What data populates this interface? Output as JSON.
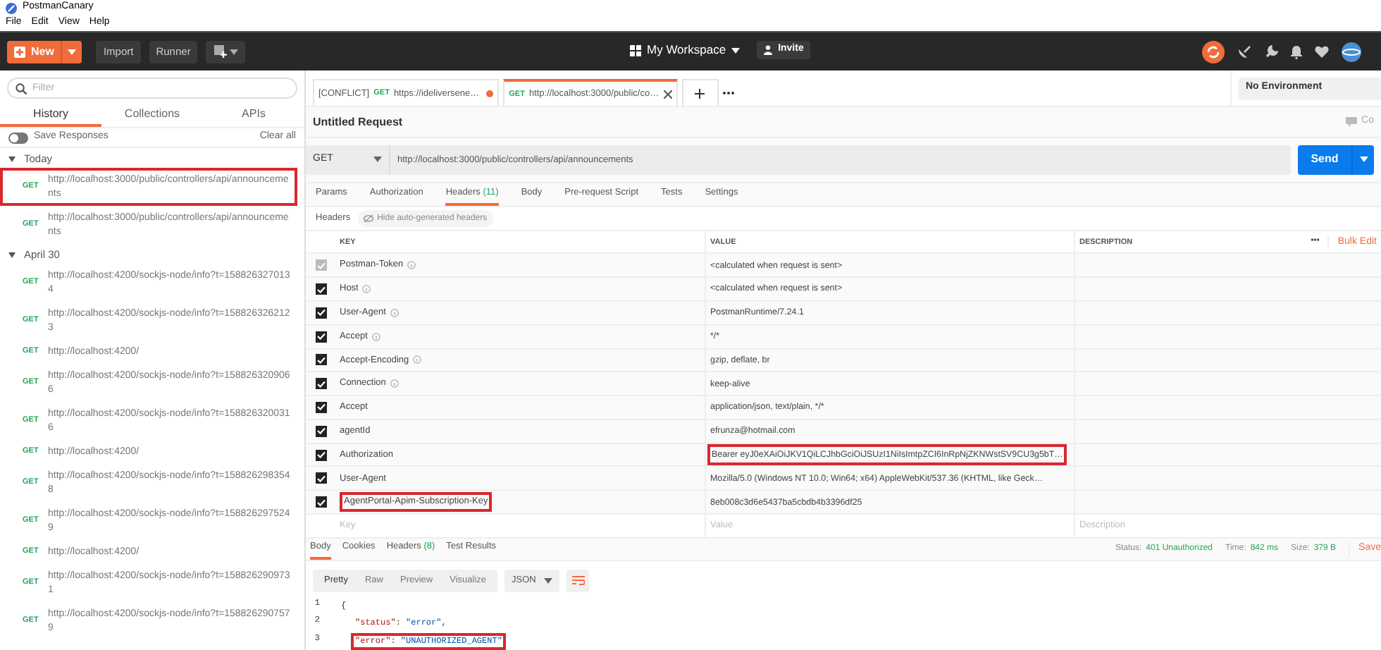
{
  "window": {
    "title": "PostmanCanary"
  },
  "menu": [
    "File",
    "Edit",
    "View",
    "Help"
  ],
  "toolbar": {
    "new": "New",
    "import": "Import",
    "runner": "Runner",
    "workspace": "My Workspace",
    "invite": "Invite"
  },
  "sidebar": {
    "filter_placeholder": "Filter",
    "tabs": [
      {
        "label": "History",
        "selected": true
      },
      {
        "label": "Collections",
        "selected": false
      },
      {
        "label": "APIs",
        "selected": false
      }
    ],
    "save_responses": {
      "label": "Save Responses",
      "on": false
    },
    "clear_all": "Clear all",
    "groups": [
      {
        "label": "Today",
        "expanded": true,
        "items": [
          {
            "method": "GET",
            "url": "http://localhost:3000/public/controllers/api/announcements",
            "highlighted": true
          },
          {
            "method": "GET",
            "url": "http://localhost:3000/public/controllers/api/announcements",
            "highlighted": false
          }
        ]
      },
      {
        "label": "April 30",
        "expanded": true,
        "items": [
          {
            "method": "GET",
            "url": "http://localhost:4200/sockjs-node/info?t=1588263270134",
            "highlighted": false
          },
          {
            "method": "GET",
            "url": "http://localhost:4200/sockjs-node/info?t=1588263262123",
            "highlighted": false
          },
          {
            "method": "GET",
            "url": "http://localhost:4200/",
            "highlighted": false
          },
          {
            "method": "GET",
            "url": "http://localhost:4200/sockjs-node/info?t=1588263209066",
            "highlighted": false
          },
          {
            "method": "GET",
            "url": "http://localhost:4200/sockjs-node/info?t=1588263200316",
            "highlighted": false
          },
          {
            "method": "GET",
            "url": "http://localhost:4200/",
            "highlighted": false
          },
          {
            "method": "GET",
            "url": "http://localhost:4200/sockjs-node/info?t=1588262983548",
            "highlighted": false
          },
          {
            "method": "GET",
            "url": "http://localhost:4200/sockjs-node/info?t=1588262975249",
            "highlighted": false
          },
          {
            "method": "GET",
            "url": "http://localhost:4200/",
            "highlighted": false
          },
          {
            "method": "GET",
            "url": "http://localhost:4200/sockjs-node/info?t=1588262909731",
            "highlighted": false
          },
          {
            "method": "GET",
            "url": "http://localhost:4200/sockjs-node/info?t=1588262907579",
            "highlighted": false
          }
        ]
      }
    ]
  },
  "request_tabs": [
    {
      "prefix": "[CONFLICT]",
      "method": "GET",
      "label": "https://ideliversene…",
      "selected": false,
      "unsaved": true
    },
    {
      "method": "GET",
      "label": "http://localhost:3000/public/co…",
      "selected": true,
      "unsaved": false
    }
  ],
  "environment": "No Environment",
  "request": {
    "title": "Untitled Request",
    "comments": "Co",
    "method": "GET",
    "url": "http://localhost:3000/public/controllers/api/announcements",
    "send": "Send"
  },
  "request_sections": [
    {
      "label": "Params",
      "selected": false
    },
    {
      "label": "Authorization",
      "selected": false
    },
    {
      "label": "Headers",
      "count": "(11)",
      "selected": true
    },
    {
      "label": "Body",
      "selected": false
    },
    {
      "label": "Pre-request Script",
      "selected": false
    },
    {
      "label": "Tests",
      "selected": false
    },
    {
      "label": "Settings",
      "selected": false
    }
  ],
  "headers_bar": {
    "label": "Headers",
    "toggle": "Hide auto-generated headers"
  },
  "headers_table": {
    "columns": [
      "KEY",
      "VALUE",
      "DESCRIPTION"
    ],
    "more": "•••",
    "bulk_edit": "Bulk Edit",
    "rows": [
      {
        "key": "Postman-Token",
        "value": "<calculated when request is sent>",
        "checked": true,
        "disabled": true,
        "info": true,
        "highlight_key": false,
        "highlight_value": false
      },
      {
        "key": "Host",
        "value": "<calculated when request is sent>",
        "checked": true,
        "disabled": false,
        "info": true,
        "highlight_key": false,
        "highlight_value": false
      },
      {
        "key": "User-Agent",
        "value": "PostmanRuntime/7.24.1",
        "checked": true,
        "disabled": false,
        "info": true,
        "highlight_key": false,
        "highlight_value": false
      },
      {
        "key": "Accept",
        "value": "*/*",
        "checked": true,
        "disabled": false,
        "info": true,
        "highlight_key": false,
        "highlight_value": false
      },
      {
        "key": "Accept-Encoding",
        "value": "gzip, deflate, br",
        "checked": true,
        "disabled": false,
        "info": true,
        "highlight_key": false,
        "highlight_value": false
      },
      {
        "key": "Connection",
        "value": "keep-alive",
        "checked": true,
        "disabled": false,
        "info": true,
        "highlight_key": false,
        "highlight_value": false
      },
      {
        "key": "Accept",
        "value": "application/json, text/plain, */*",
        "checked": true,
        "disabled": false,
        "info": false,
        "highlight_key": false,
        "highlight_value": false
      },
      {
        "key": "agentId",
        "value": "efrunza@hotmail.com",
        "checked": true,
        "disabled": false,
        "info": false,
        "highlight_key": false,
        "highlight_value": false
      },
      {
        "key": "Authorization",
        "value": "Bearer eyJ0eXAiOiJKV1QiLCJhbGciOiJSUzI1NiIsImtpZCI6InRpNjZKNWstSV9CU3g5bT…",
        "checked": true,
        "disabled": false,
        "info": false,
        "highlight_key": false,
        "highlight_value": true
      },
      {
        "key": "User-Agent",
        "value": "Mozilla/5.0 (Windows NT 10.0; Win64; x64) AppleWebKit/537.36 (KHTML, like Geck…",
        "checked": true,
        "disabled": false,
        "info": false,
        "highlight_key": false,
        "highlight_value": false
      },
      {
        "key": "AgentPortal-Apim-Subscription-Key",
        "value": "8eb008c3d6e5437ba5cbdb4b3396df25",
        "checked": true,
        "disabled": false,
        "info": false,
        "highlight_key": true,
        "highlight_value": false
      }
    ],
    "new_row": {
      "key_placeholder": "Key",
      "value_placeholder": "Value",
      "description_placeholder": "Description"
    }
  },
  "response": {
    "tabs": [
      {
        "label": "Body",
        "selected": true
      },
      {
        "label": "Cookies",
        "selected": false
      },
      {
        "label": "Headers",
        "count": "(8)",
        "selected": false
      },
      {
        "label": "Test Results",
        "selected": false
      }
    ],
    "status_label": "Status:",
    "status": "401 Unauthorized",
    "time_label": "Time:",
    "time": "842 ms",
    "size_label": "Size:",
    "size": "379 B",
    "save": "Save",
    "views": [
      {
        "label": "Pretty",
        "selected": true
      },
      {
        "label": "Raw",
        "selected": false
      },
      {
        "label": "Preview",
        "selected": false
      },
      {
        "label": "Visualize",
        "selected": false
      }
    ],
    "format": "JSON",
    "lines": [
      {
        "number": "1",
        "text": "{",
        "highlighted": false
      },
      {
        "number": "2",
        "key": "\"status\"",
        "sep": ": ",
        "value": "\"error\"",
        "end": ",",
        "highlighted": false
      },
      {
        "number": "3",
        "key": "\"error\"",
        "sep": ": ",
        "value": "\"UNAUTHORIZED_AGENT\"",
        "highlighted": true
      }
    ]
  }
}
